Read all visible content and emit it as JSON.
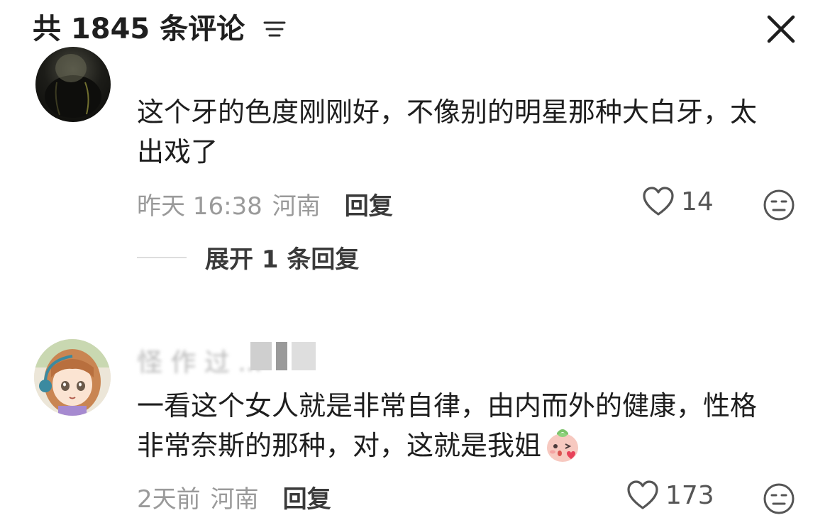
{
  "header": {
    "title": "共 1845 条评论",
    "filter_icon": "filter-lines-icon",
    "close_icon": "close-icon"
  },
  "comments": [
    {
      "avatar": "user-avatar-dark",
      "text": "这个牙的色度刚刚好，不像别的明星那种大白牙，太出戏了",
      "time": "昨天 16:38",
      "location": "河南",
      "reply_label": "回复",
      "likes": "14",
      "expand_label": "展开 1 条回复"
    },
    {
      "avatar": "user-avatar-anime-girl",
      "username": "怪 作 过 ...",
      "text": "一看这个女人就是非常自律，由内而外的健康，性格非常奈斯的那种，对，这就是我姐",
      "emoji": "blush-emoji",
      "time": "2天前",
      "location": "河南",
      "reply_label": "回复",
      "likes": "173"
    }
  ],
  "colors": {
    "text": "#1e1e1e",
    "meta": "#9a9a9a",
    "reply": "#3a3a3a",
    "like_icon": "#555555"
  }
}
